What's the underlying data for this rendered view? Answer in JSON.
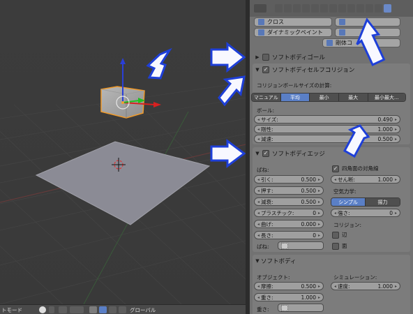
{
  "viewport": {
    "header": {
      "mode_label": "トモード",
      "orientation_label": "グローバル"
    }
  },
  "properties": {
    "physics_buttons": {
      "cloth": "クロス",
      "dynamic_paint": "ダイナミックペイント",
      "rigid_body_constraint": "剛体コ"
    },
    "goal_section": {
      "title": "ソフトボディゴール",
      "enabled": false
    },
    "self_collision": {
      "title": "ソフトボディセルフコリジョン",
      "enabled": true,
      "calc_label": "コリジョンボールサイズの計算:",
      "modes": [
        "マニュアル",
        "平均",
        "最小",
        "最大",
        "最小最大..."
      ],
      "active_mode": "平均",
      "ball_label": "ボール:",
      "fields": [
        {
          "name": "サイズ:",
          "value": "0.490"
        },
        {
          "name": "剛性:",
          "value": "1.000"
        },
        {
          "name": "減速:",
          "value": "0.500"
        }
      ]
    },
    "edges": {
      "title": "ソフトボディエッジ",
      "enabled": true,
      "spring_label": "ばね:",
      "left_fields": [
        {
          "name": "引く:",
          "value": "0.500"
        },
        {
          "name": "押す:",
          "value": "0.500"
        },
        {
          "name": "減衰:",
          "value": "0.500"
        },
        {
          "name": "プラスチック:",
          "value": "0"
        },
        {
          "name": "曲げ:",
          "value": "0.000"
        },
        {
          "name": "長さ:",
          "value": "0"
        }
      ],
      "quad_diagonal_label": "四角面の対角線",
      "quad_diagonal": true,
      "shear": {
        "name": "せん断:",
        "value": "1.000"
      },
      "aero_label": "空気力学:",
      "aero_modes": [
        "シンプル",
        "揚力"
      ],
      "aero_active": "シンプル",
      "strength": {
        "name": "強さ:",
        "value": "0"
      },
      "collision_label": "コリジョン:",
      "edge_label": "辺",
      "face_label": "面",
      "spring_picker_label": "ばね:"
    },
    "softbody": {
      "title": "ソフトボディ",
      "object_label": "オブジェクト:",
      "simulation_label": "シミュレーション:",
      "friction": {
        "name": "摩擦:",
        "value": "0.500"
      },
      "mass": {
        "name": "重さ:",
        "value": "1.000"
      },
      "speed": {
        "name": "速度:",
        "value": "1.000"
      },
      "weight_label": "重さ:"
    }
  },
  "colors": {
    "accent": "#5a7fc6",
    "annotation_arrow": "#1e3fd8",
    "selection_outline": "#f09a2a"
  }
}
